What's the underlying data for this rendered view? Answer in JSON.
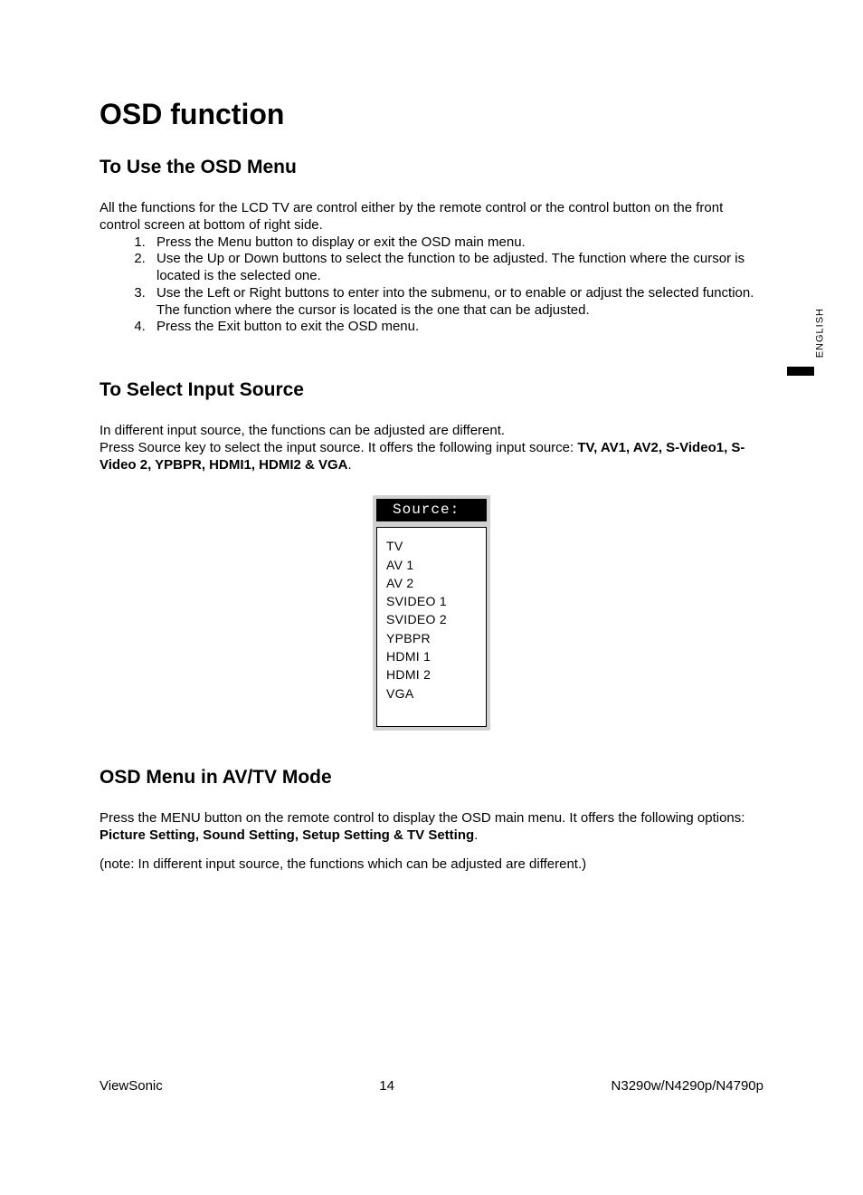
{
  "side_tab": "ENGLISH",
  "title": "OSD function",
  "sections": {
    "use_menu": {
      "heading": "To Use the OSD Menu",
      "intro": "All the functions for the LCD TV are control either by the remote control or the control button on the front control screen at bottom of right side.",
      "steps": [
        "Press the Menu button to display or exit the OSD main menu.",
        "Use the Up or Down buttons to select the function to be adjusted. The function where the cursor is located is the selected one.",
        "Use the Left or Right buttons to enter into the submenu, or to enable or adjust the selected function. The function where the cursor is located is the one that can be adjusted.",
        "Press the Exit button to exit the OSD menu."
      ]
    },
    "select_input": {
      "heading": "To Select Input Source",
      "p1": "In different input source, the functions can be adjusted are different.",
      "p2_prefix": "Press Source key to select the input source. It offers the following input source: ",
      "p2_bold": "TV, AV1, AV2, S-Video1, S-Video 2, YPBPR, HDMI1, HDMI2 & VGA",
      "p2_suffix": ".",
      "source_box": {
        "header": "Source:",
        "items": [
          "TV",
          "AV 1",
          "AV 2",
          "SVIDEO 1",
          "SVIDEO 2",
          "YPBPR",
          "HDMI 1",
          "HDMI 2",
          "VGA"
        ]
      }
    },
    "avtv": {
      "heading": "OSD Menu in AV/TV Mode",
      "p1_prefix": "Press the MENU button on the remote control to display the OSD main menu. It offers the following options: ",
      "p1_bold": "Picture Setting, Sound Setting, Setup Setting & TV Setting",
      "p1_suffix": ".",
      "note": "(note: In different input source, the functions which can be adjusted are different.)"
    }
  },
  "footer": {
    "brand": "ViewSonic",
    "page": "14",
    "model": "N3290w/N4290p/N4790p"
  }
}
